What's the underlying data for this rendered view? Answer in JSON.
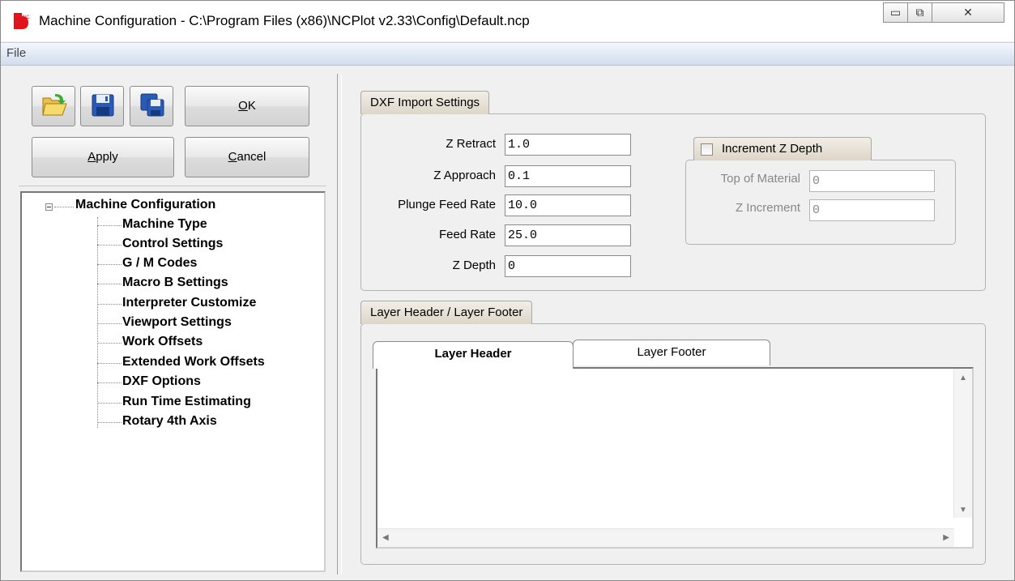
{
  "window": {
    "title": "Machine Configuration - C:\\Program Files (x86)\\NCPlot v2.33\\Config\\Default.ncp",
    "app_icon": "ncplot-logo-icon",
    "controls": [
      "minimize-icon",
      "restore-icon",
      "close-icon"
    ]
  },
  "menu": {
    "file": "File"
  },
  "toolbar": {
    "open_icon": "folder-open-icon",
    "save_icon": "floppy-disk-icon",
    "save_as_icon": "save-multiple-icon",
    "ok_label": "OK",
    "apply_label": "Apply",
    "cancel_label": "Cancel"
  },
  "tree": {
    "root": "Machine Configuration",
    "items": [
      "Machine Type",
      "Control Settings",
      "G / M Codes",
      "Macro B Settings",
      "Interpreter Customize",
      "Viewport Settings",
      "Work Offsets",
      "Extended Work Offsets",
      "DXF Options",
      "Run Time Estimating",
      "Rotary 4th Axis"
    ]
  },
  "dxf": {
    "group_title": "DXF Import Settings",
    "fields": [
      {
        "label": "Z Retract",
        "value": "1.0"
      },
      {
        "label": "Z Approach",
        "value": "0.1"
      },
      {
        "label": "Plunge Feed Rate",
        "value": "10.0"
      },
      {
        "label": "Feed Rate",
        "value": "25.0"
      },
      {
        "label": "Z Depth",
        "value": "0"
      }
    ],
    "increment": {
      "title": "Increment Z Depth",
      "checked": false,
      "top_label": "Top of Material",
      "top_value": "0",
      "inc_label": "Z Increment",
      "inc_value": "0"
    }
  },
  "layer": {
    "group_title": "Layer Header / Layer Footer",
    "tabs": [
      "Layer Header",
      "Layer Footer"
    ],
    "active_tab": "Layer Header",
    "content": ""
  }
}
